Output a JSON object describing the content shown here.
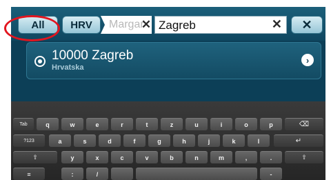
{
  "topbar": {
    "all_label": "All",
    "country_label": "HRV",
    "crumb_text": "Margar",
    "crumb_clear": "✕",
    "search_value": "Zagreb",
    "search_clear": "✕",
    "close_label": "✕"
  },
  "highlight_color": "#e2151f",
  "result": {
    "title": "10000 Zagreb",
    "subtitle": "Hrvatska",
    "chevron": "›"
  },
  "keyboard": {
    "row1": [
      "Tab",
      "q",
      "w",
      "e",
      "r",
      "t",
      "z",
      "u",
      "i",
      "o",
      "p",
      "⌫"
    ],
    "row2": [
      "?123",
      "a",
      "s",
      "d",
      "f",
      "g",
      "h",
      "j",
      "k",
      "l",
      "↵"
    ],
    "row3": [
      "⇧",
      "y",
      "x",
      "c",
      "v",
      "b",
      "n",
      "m",
      ",",
      ".",
      "⇧"
    ],
    "row4": [
      "≡",
      ":",
      "/",
      "",
      "",
      "-"
    ]
  }
}
